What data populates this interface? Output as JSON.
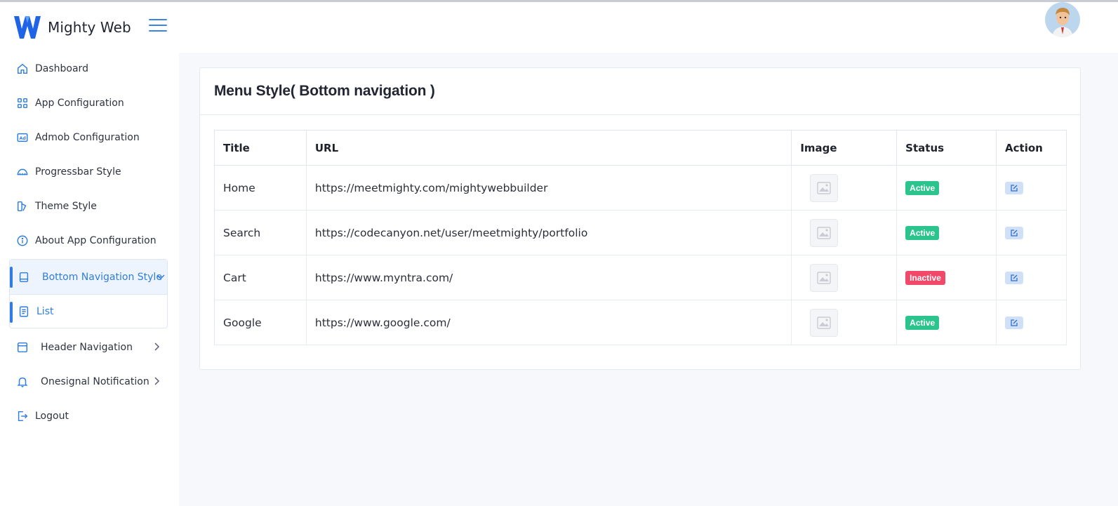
{
  "app": {
    "name": "Mighty Web"
  },
  "sidebar": {
    "items": [
      {
        "label": "Dashboard",
        "icon": "home-icon"
      },
      {
        "label": "App Configuration",
        "icon": "grid-icon"
      },
      {
        "label": "Admob Configuration",
        "icon": "ad-icon"
      },
      {
        "label": "Progressbar Style",
        "icon": "gauge-icon"
      },
      {
        "label": "Theme Style",
        "icon": "palette-icon"
      },
      {
        "label": "About App Configuration",
        "icon": "info-icon"
      }
    ],
    "active_group": {
      "label": "Bottom Navigation Style",
      "sub_label": "List"
    },
    "after_items": [
      {
        "label": "Header Navigation",
        "icon": "window-icon"
      },
      {
        "label": "Onesignal Notification",
        "icon": "bell-icon"
      },
      {
        "label": "Logout",
        "icon": "logout-icon"
      }
    ]
  },
  "page": {
    "title": "Menu Style( Bottom navigation )"
  },
  "table": {
    "headers": [
      "Title",
      "URL",
      "Image",
      "Status",
      "Action"
    ],
    "rows": [
      {
        "title": "Home",
        "url": "https://meetmighty.com/mightywebbuilder",
        "status": "Active"
      },
      {
        "title": "Search",
        "url": "https://codecanyon.net/user/meetmighty/portfolio",
        "status": "Active"
      },
      {
        "title": "Cart",
        "url": "https://www.myntra.com/",
        "status": "Inactive"
      },
      {
        "title": "Google",
        "url": "https://www.google.com/",
        "status": "Active"
      }
    ]
  },
  "colors": {
    "accent": "#2f7de1",
    "active": "#2bc48d",
    "inactive": "#f2496b"
  }
}
